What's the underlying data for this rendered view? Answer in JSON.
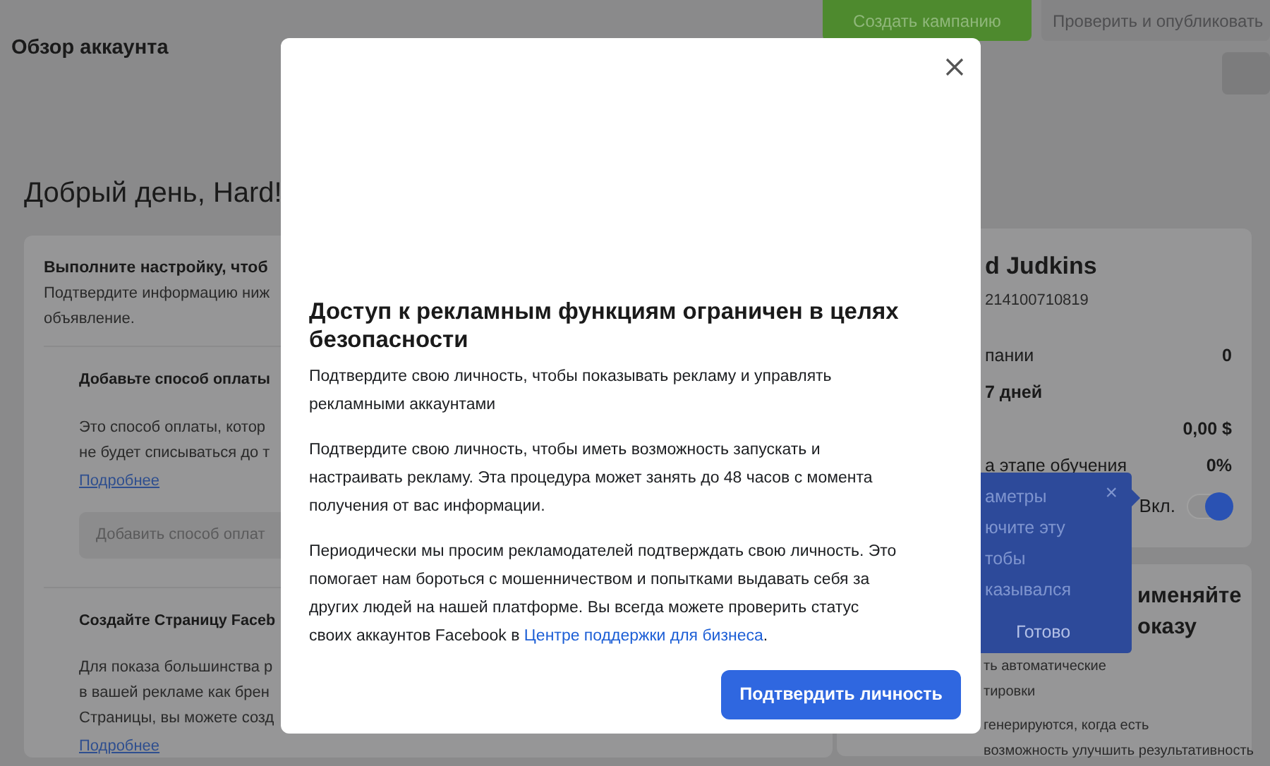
{
  "page_title": "Обзор аккаунта",
  "header_buttons": [
    {
      "label": "Создать кампанию",
      "kind": "primary"
    },
    {
      "label": "Проверить и опубликовать",
      "kind": "secondary"
    }
  ],
  "greeting": "Добрый день, Hard!",
  "setup_card": {
    "title": "Выполните настройку, чтоб",
    "text_lines": [
      "Подтвердите информацию ниж",
      "объявление."
    ],
    "sections": [
      {
        "title": "Добавьте способ оплаты",
        "text_lines": [
          "Это способ оплаты, котор",
          "не будет списываться до т"
        ],
        "link": "Подробнее",
        "button": {
          "label": "Добавить способ оплат",
          "disabled": true
        }
      },
      {
        "title": "Создайте Страницу Faceb",
        "text_lines": [
          "Для показа большинства р",
          "в вашей рекламе как брен",
          "Страницы, вы можете созд"
        ],
        "link": "Подробнее"
      }
    ]
  },
  "account_card": {
    "name": "d Judkins",
    "account_id": "214100710819",
    "stats": [
      {
        "label": "пании",
        "value": "0"
      },
      {
        "label": "7 дней"
      },
      {
        "value": "0,00 $"
      },
      {
        "label": "а этапе обучения",
        "value": "0%"
      }
    ],
    "toggle": {
      "label": "Вкл.",
      "on": true
    }
  },
  "popover": {
    "lines": [
      "аметры",
      "ючите эту",
      "тобы",
      "казывался"
    ],
    "close": "×",
    "button": "Готово"
  },
  "tips_card": {
    "title_lines": [
      "именяйте",
      "оказу"
    ],
    "text_lines": [
      "ть автоматические",
      "тировки"
    ],
    "text2_lines": [
      "генерируются, когда есть",
      "возможность улучшить результативность"
    ]
  },
  "modal": {
    "title": "Доступ к рекламным функциям ограничен в целях безопасности",
    "paragraphs": [
      {
        "text": "Подтвердите свою личность, чтобы показывать рекламу и управлять рекламными аккаунтами"
      },
      {
        "text": "Подтвердите свою личность, чтобы иметь возможность запускать и настраивать рекламу. Эта процедура может занять до 48 часов с момента получения от вас информации."
      },
      {
        "text": "Периодически мы просим рекламодателей подтверждать свою личность. Это помогает нам бороться с мошенничеством и попытками выдавать себя за других людей на нашей платформе. Вы всегда можете проверить статус своих аккаунтов Facebook в ",
        "link": "Центре поддержки для бизнеса",
        "suffix": "."
      }
    ],
    "button": "Подтвердить личность"
  }
}
